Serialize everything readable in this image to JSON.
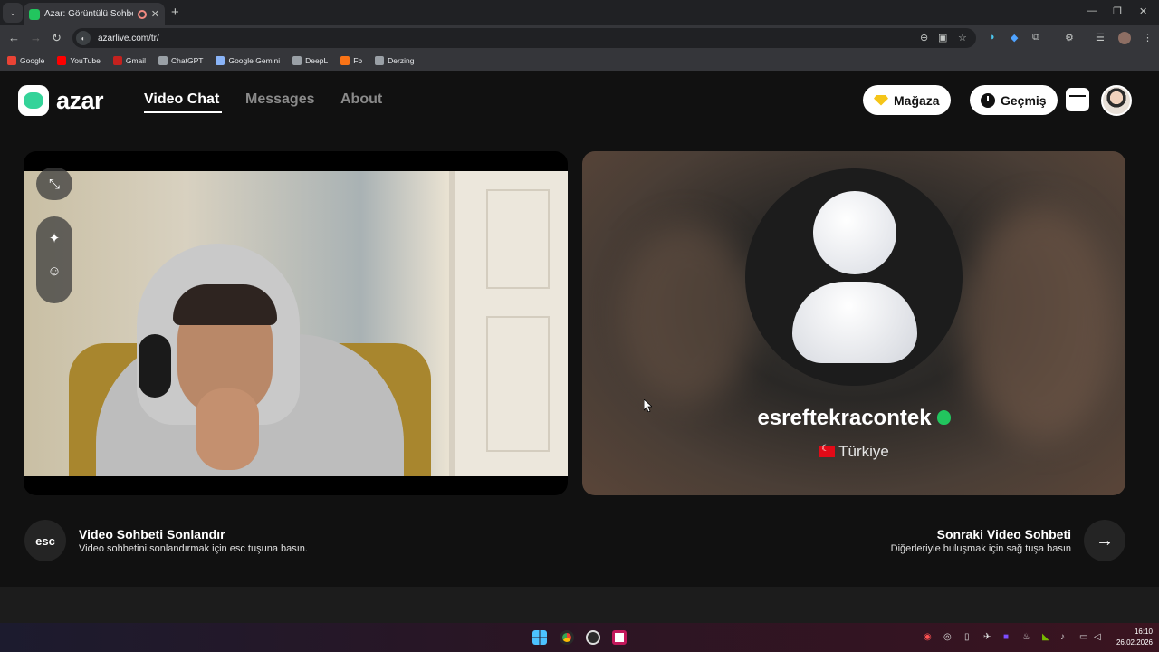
{
  "browser": {
    "tab_title": "Azar: Görüntülü Sohbet & Y",
    "tab_close": "✕",
    "new_tab": "+",
    "url": "azarlive.com/tr/",
    "bookmarks": [
      {
        "label": "Google",
        "color": "#ea4335"
      },
      {
        "label": "YouTube",
        "color": "#ff0000"
      },
      {
        "label": "Gmail",
        "color": "#c5221f"
      },
      {
        "label": "ChatGPT",
        "color": "#9aa0a6"
      },
      {
        "label": "Google Gemini",
        "color": "#8ab4f8"
      },
      {
        "label": "DeepL",
        "color": "#9aa0a6"
      },
      {
        "label": "Fb",
        "color": "#f97316"
      },
      {
        "label": "Derzing",
        "color": "#9aa0a6"
      }
    ]
  },
  "header": {
    "logo_text": "azar",
    "nav": [
      "Video Chat",
      "Messages",
      "About"
    ],
    "store_label": "Mağaza",
    "history_label": "Geçmiş"
  },
  "partner": {
    "username": "esreftekracontek",
    "country": "Türkiye"
  },
  "controls": {
    "end_key": "esc",
    "end_title": "Video Sohbeti Sonlandır",
    "end_sub": "Video sohbetini sonlandırmak için esc tuşuna basın.",
    "next_title": "Sonraki Video Sohbeti",
    "next_sub": "Diğerleriyle buluşmak için sağ tuşa basın",
    "next_icon": "→"
  },
  "taskbar": {
    "time": "16:10",
    "date": "26.02.2026"
  },
  "colors": {
    "accent_green": "#22c55e",
    "store_diamond": "#f5c518",
    "page_bg": "#111111"
  }
}
